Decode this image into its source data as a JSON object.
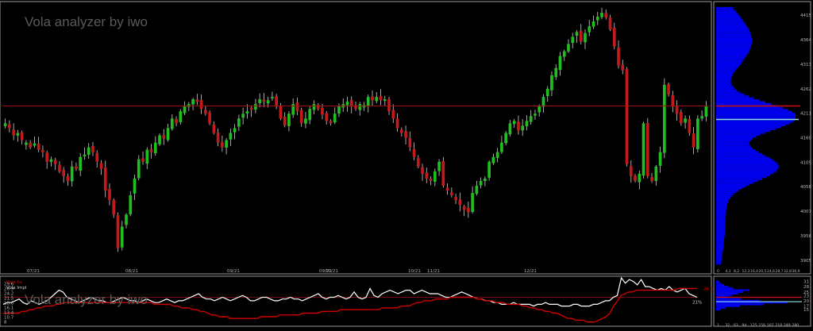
{
  "watermark": "Vola analyzer by iwo",
  "colors": {
    "background": "#000000",
    "frame": "#9a9a9a",
    "bull": "#1fbf1f",
    "bear": "#c41a1a",
    "ref_line": "#a01010",
    "profile": "#0000f0",
    "profile_marker_red": "#d01010",
    "profile_marker_cyan": "#8ee6e6",
    "hv_line": "#ffffff",
    "iv_line": "#d00000",
    "axis_text": "#b8b8b8"
  },
  "price_panel": {
    "reference_level": 4226,
    "x_labels": [
      "07/21",
      "08/21",
      "09/21",
      "09/21",
      "10/21",
      "10/21",
      "11/21",
      "12/21"
    ]
  },
  "vola_panel": {
    "hv_end_label": "21%",
    "iv_end_label": "26.6",
    "reference_level": 22
  },
  "chart_data": [
    {
      "type": "candlestick",
      "title": "",
      "ylim": [
        3880,
        4440
      ],
      "y_ticks": [
        "4415",
        "4364",
        "4313",
        "4262",
        "4211",
        "4160",
        "4109",
        "4058",
        "4007",
        "3956",
        "3905"
      ],
      "x_ticks": [
        "07/21",
        "08/21",
        "09/21",
        "09/21",
        "10/21",
        "10/21",
        "11/21",
        "12/21"
      ],
      "close": [
        4190,
        4180,
        4165,
        4170,
        4155,
        4150,
        4140,
        4148,
        4135,
        4130,
        4110,
        4115,
        4105,
        4090,
        4080,
        4070,
        4100,
        4095,
        4120,
        4125,
        4140,
        4130,
        4110,
        4095,
        4050,
        4030,
        4000,
        3930,
        3975,
        4000,
        4040,
        4075,
        4115,
        4110,
        4135,
        4130,
        4150,
        4165,
        4158,
        4180,
        4200,
        4190,
        4215,
        4225,
        4230,
        4240,
        4235,
        4220,
        4210,
        4190,
        4170,
        4150,
        4140,
        4155,
        4170,
        4180,
        4200,
        4210,
        4215,
        4218,
        4230,
        4240,
        4235,
        4238,
        4245,
        4225,
        4200,
        4185,
        4210,
        4230,
        4215,
        4190,
        4200,
        4220,
        4230,
        4220,
        4208,
        4195,
        4190,
        4210,
        4225,
        4230,
        4235,
        4225,
        4220,
        4230,
        4228,
        4245,
        4238,
        4245,
        4238,
        4240,
        4215,
        4200,
        4180,
        4170,
        4160,
        4140,
        4120,
        4100,
        4085,
        4075,
        4070,
        4090,
        4110,
        4060,
        4050,
        4040,
        4030,
        4020,
        4010,
        4005,
        4045,
        4060,
        4070,
        4075,
        4110,
        4120,
        4130,
        4150,
        4170,
        4190,
        4195,
        4175,
        4185,
        4195,
        4205,
        4210,
        4225,
        4245,
        4262,
        4290,
        4305,
        4330,
        4340,
        4355,
        4370,
        4380,
        4360,
        4378,
        4392,
        4402,
        4412,
        4420,
        4410,
        4385,
        4350,
        4310,
        4300,
        4105,
        4080,
        4070,
        4085,
        4190,
        4080,
        4070,
        4100,
        4130,
        4270,
        4250,
        4225,
        4210,
        4190,
        4200,
        4170,
        4140,
        4200,
        4205,
        4225
      ],
      "profile_levels": {
        "values": [
          "4415",
          "4364",
          "4313",
          "4262",
          "4211",
          "4160",
          "4109",
          "4058",
          "4007",
          "3956",
          "3905"
        ]
      },
      "profile_x_ticks": [
        "0",
        "4,1",
        "8,2",
        "12,3",
        "16,4",
        "20,5",
        "24,6",
        "28,7",
        "32,8",
        "36,9"
      ]
    },
    {
      "type": "line",
      "title": "",
      "ylim": [
        6.5,
        33
      ],
      "y_ticks": [
        "29.6",
        "26.9",
        "24.2",
        "21.5",
        "18.8",
        "16.1",
        "13.4",
        "10.7",
        "8"
      ],
      "series": [
        {
          "name": "Vola Impl",
          "values": [
            18,
            19,
            19,
            20,
            21,
            19,
            18,
            20,
            19,
            18,
            19,
            20,
            22,
            24,
            26,
            25,
            22,
            21,
            20,
            19,
            20,
            21,
            22,
            21,
            20,
            20,
            19,
            19,
            20,
            21,
            22,
            21,
            20,
            20,
            19,
            20,
            21,
            20,
            19,
            19,
            20,
            21,
            20,
            19,
            20,
            20,
            21,
            22,
            23,
            24,
            22,
            21,
            21,
            20,
            21,
            22,
            21,
            20,
            21,
            22,
            23,
            22,
            20,
            20,
            21,
            22,
            22,
            21,
            20,
            20,
            21,
            21,
            22,
            21,
            21,
            20,
            21,
            22,
            23,
            24,
            22,
            21,
            22,
            22,
            23,
            22,
            21,
            22,
            25,
            22,
            21,
            22,
            27,
            23,
            22,
            24,
            25,
            26,
            25,
            24,
            25,
            26,
            26,
            24,
            25,
            26,
            25,
            24,
            24,
            24,
            23,
            22,
            22,
            23,
            24,
            25,
            24,
            23,
            22,
            21,
            21,
            20,
            20,
            19,
            19,
            18,
            18,
            18,
            19,
            18,
            18,
            18,
            18,
            17,
            18,
            18,
            19,
            18,
            18,
            18,
            17,
            17,
            17,
            18,
            18,
            17,
            17,
            17,
            18,
            18,
            19,
            20,
            20,
            22,
            23,
            33,
            30,
            32,
            31,
            29,
            32,
            28,
            28,
            27,
            26,
            27,
            26,
            28,
            26,
            25,
            26,
            27,
            24,
            23,
            22
          ]
        },
        {
          "name": "Vola hv",
          "values": [
            13,
            13,
            13,
            13,
            13,
            14,
            14,
            15,
            15,
            16,
            16,
            17,
            17,
            17,
            18,
            18,
            19,
            19,
            19,
            19,
            19,
            19,
            19,
            19,
            19,
            19,
            19,
            19,
            19,
            19,
            19,
            19,
            19,
            19,
            19,
            19,
            19,
            19,
            19,
            19,
            18,
            18,
            18,
            18,
            18,
            17,
            17,
            16,
            16,
            16,
            15,
            15,
            14,
            14,
            13,
            12,
            12,
            11,
            11,
            11,
            10,
            10,
            10,
            10,
            10,
            10,
            10,
            10,
            11,
            11,
            11,
            11,
            11,
            12,
            12,
            12,
            12,
            12,
            12,
            13,
            13,
            13,
            13,
            13,
            14,
            14,
            14,
            14,
            14,
            15,
            15,
            15,
            15,
            15,
            15,
            15,
            15,
            15,
            15,
            15,
            16,
            16,
            16,
            16,
            16,
            17,
            17,
            17,
            18,
            19,
            19,
            20,
            20,
            20,
            21,
            21,
            21,
            21,
            22,
            22,
            22,
            22,
            22,
            22,
            22,
            21,
            21,
            20,
            20,
            20,
            19,
            19,
            19,
            18,
            18,
            18,
            18,
            17,
            17,
            16,
            16,
            15,
            15,
            14,
            14,
            13,
            13,
            12,
            11,
            10,
            10,
            9,
            9,
            9,
            8,
            8,
            8,
            9,
            10,
            11,
            13,
            17,
            20,
            23,
            24,
            25,
            25,
            26,
            26,
            26,
            26,
            26,
            26,
            26,
            26,
            26,
            26,
            26,
            27,
            27,
            27,
            27,
            27,
            27
          ]
        }
      ],
      "profile_levels": {
        "values": [
          "31",
          "28",
          "25",
          "23",
          "20",
          "17",
          "15"
        ]
      },
      "profile_x_ticks": [
        "1",
        "32",
        "63",
        "94",
        "125",
        "156",
        "187",
        "218",
        "249",
        "280"
      ]
    }
  ]
}
